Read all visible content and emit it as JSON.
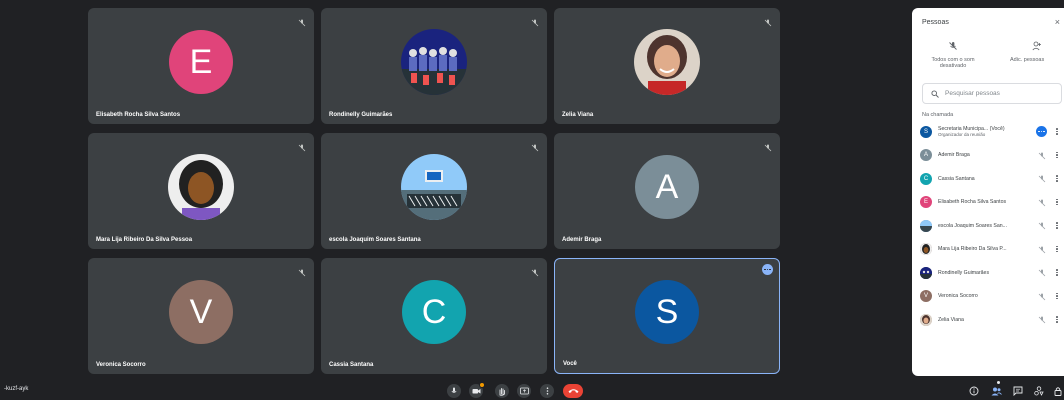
{
  "meeting": {
    "code": "-kuzf-ayk"
  },
  "tiles": [
    {
      "name": "Elisabeth Rocha Silva Santos",
      "initial": "E",
      "color": "#e0447a",
      "kind": "initial"
    },
    {
      "name": "Rondinelly Guimarães",
      "kind": "photo-group"
    },
    {
      "name": "Zelia Viana",
      "kind": "photo-woman"
    },
    {
      "name": "Mara Lija Ribeiro Da Silva Pessoa",
      "kind": "photo-portrait"
    },
    {
      "name": "escola Joaquim Soares Santana",
      "kind": "photo-building"
    },
    {
      "name": "Ademir Braga",
      "initial": "A",
      "color": "#7b8e98",
      "kind": "initial"
    },
    {
      "name": "Veronica Socorro",
      "initial": "V",
      "color": "#8d6e63",
      "kind": "initial"
    },
    {
      "name": "Cassia Santana",
      "initial": "C",
      "color": "#12a4af",
      "kind": "initial"
    },
    {
      "name": "Você",
      "initial": "S",
      "color": "#0b57a0",
      "kind": "initial"
    }
  ],
  "panel": {
    "title": "Pessoas",
    "close": "×",
    "mute_all": "Todos com o som desativado",
    "add_people": "Adic. pessoas",
    "search_placeholder": "Pesquisar pessoas",
    "section": "Na chamada",
    "participants": [
      {
        "name": "Secretaria Municipa... (Você)",
        "subtitle": "Organizador da reunião",
        "initial": "S",
        "color": "#0b57a0"
      },
      {
        "name": "Ademir Braga",
        "initial": "A",
        "color": "#7b8e98"
      },
      {
        "name": "Cassia Santana",
        "initial": "C",
        "color": "#12a4af"
      },
      {
        "name": "Elisabeth Rocha Silva Santos",
        "initial": "E",
        "color": "#e0447a"
      },
      {
        "name": "escola Joaquim Soares San...",
        "initial": "",
        "color": "#4f6f8f"
      },
      {
        "name": "Mara Lija Ribeiro Da Silva P...",
        "initial": "",
        "color": "#6d4c41"
      },
      {
        "name": "Rondinelly Guimarães",
        "initial": "",
        "color": "#37474f"
      },
      {
        "name": "Veronica Socorro",
        "initial": "V",
        "color": "#8d6e63"
      },
      {
        "name": "Zelia Viana",
        "initial": "",
        "color": "#a1887f"
      }
    ]
  },
  "colors": {
    "background": "#202124",
    "tile": "#3c4043",
    "accent": "#8ab4f8",
    "hangup": "#ea4335"
  }
}
